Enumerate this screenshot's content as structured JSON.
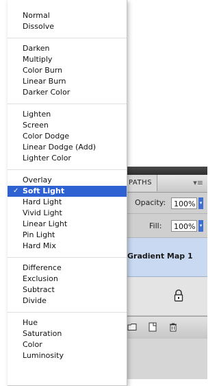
{
  "blend_menu": {
    "groups": [
      [
        "Normal",
        "Dissolve"
      ],
      [
        "Darken",
        "Multiply",
        "Color Burn",
        "Linear Burn",
        "Darker Color"
      ],
      [
        "Lighten",
        "Screen",
        "Color Dodge",
        "Linear Dodge (Add)",
        "Lighter Color"
      ],
      [
        "Overlay",
        "Soft Light",
        "Hard Light",
        "Vivid Light",
        "Linear Light",
        "Pin Light",
        "Hard Mix"
      ],
      [
        "Difference",
        "Exclusion",
        "Subtract",
        "Divide"
      ],
      [
        "Hue",
        "Saturation",
        "Color",
        "Luminosity"
      ]
    ],
    "selected": "Soft Light",
    "checkmark": "✓"
  },
  "layers_panel": {
    "tab_label": "PATHS",
    "menu_glyph": "▾≡",
    "opacity_label": "Opacity:",
    "opacity_value": "100%",
    "fill_label": "Fill:",
    "fill_value": "100%",
    "selected_layer": "Gradient Map 1",
    "stepper_glyph": "▾",
    "footer_icons": [
      "folder-icon",
      "new-layer-icon",
      "trash-icon"
    ]
  },
  "colors": {
    "selection_blue": "#2e62d3",
    "layer_selected_bg": "#c9d9f1"
  }
}
